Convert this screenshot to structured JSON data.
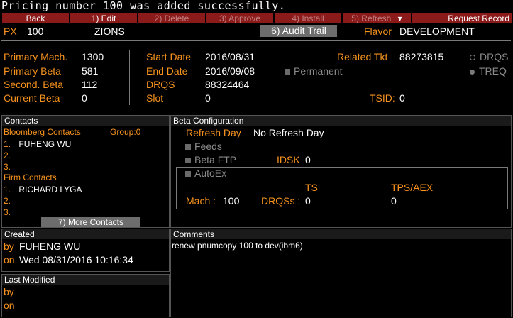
{
  "status_message": "Pricing number 100 was added successfully.",
  "toolbar": {
    "back": "Back",
    "edit": "1) Edit",
    "delete": "2) Delete",
    "approve": "3) Approve",
    "install": "4) Install",
    "refresh": "5) Refresh",
    "refresh_arrow": "▾",
    "request_record": "Request Record"
  },
  "header": {
    "px_label": "PX",
    "px_value": "100",
    "px_name": "ZIONS",
    "audit_trail": "6) Audit Trail",
    "flavor_label": "Flavor",
    "flavor_value": "DEVELOPMENT"
  },
  "details": {
    "primary_mach_label": "Primary Mach.",
    "primary_mach_value": "1300",
    "primary_beta_label": "Primary Beta",
    "primary_beta_value": "581",
    "second_beta_label": "Second. Beta",
    "second_beta_value": "112",
    "current_beta_label": "Current Beta",
    "current_beta_value": "0",
    "start_date_label": "Start Date",
    "start_date_value": "2016/08/31",
    "end_date_label": "End Date",
    "end_date_value": "2016/09/08",
    "drqs_label": "DRQS",
    "drqs_value": "88324464",
    "slot_label": "Slot",
    "slot_value": "0",
    "related_tkt_label": "Related Tkt",
    "related_tkt_value": "88273815",
    "permanent_label": "Permanent",
    "tsid_label": "TSID:",
    "tsid_value": "0",
    "radio_drqs": "DRQS",
    "radio_treq": "TREQ"
  },
  "contacts": {
    "title": "Contacts",
    "bloomberg_label": "Bloomberg Contacts",
    "group_label": "Group:0",
    "bloomberg_items": [
      "FUHENG WU",
      "",
      ""
    ],
    "firm_label": "Firm Contacts",
    "firm_items": [
      "RICHARD LYGA",
      "",
      ""
    ],
    "more_button": "7) More Contacts"
  },
  "beta_config": {
    "title": "Beta Configuration",
    "refresh_day_label": "Refresh Day",
    "refresh_day_value": "No Refresh Day",
    "feeds_label": "Feeds",
    "beta_ftp_label": "Beta FTP",
    "idsk_label": "IDSK",
    "idsk_value": "0",
    "autoex_label": "AutoEx",
    "ts_header": "TS",
    "tps_header": "TPS/AEX",
    "mach_label": "Mach :",
    "mach_value": "100",
    "drqss_label": "DRQSs :",
    "drqss_value": "0",
    "tps_value": "0"
  },
  "created": {
    "title": "Created",
    "by_label": "by",
    "by_value": "FUHENG WU",
    "on_label": "on",
    "on_value": "Wed 08/31/2016 10:16:34"
  },
  "comments": {
    "title": "Comments",
    "text": "renew pnumcopy 100 to dev(ibm6)"
  },
  "last_modified": {
    "title": "Last Modified",
    "by_label": "by",
    "on_label": "on"
  }
}
